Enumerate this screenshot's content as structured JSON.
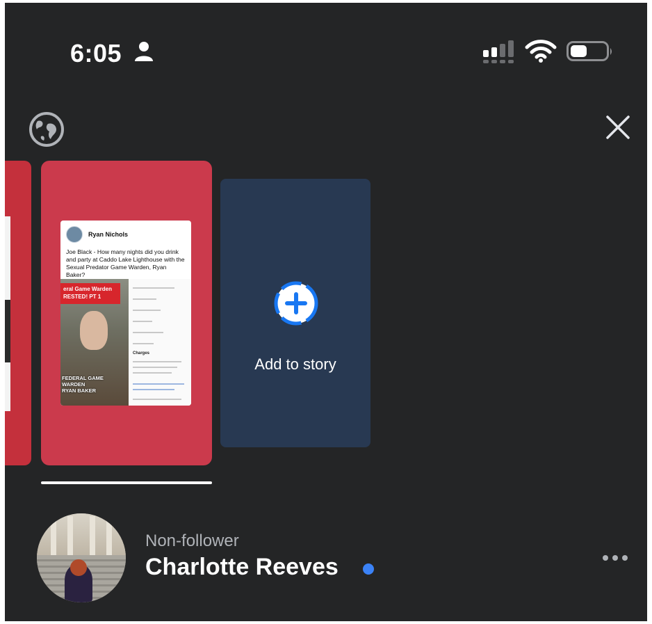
{
  "status_bar": {
    "time": "6:05",
    "person_icon": "person-icon",
    "signal_icon": "cellular-signal-icon",
    "wifi_icon": "wifi-icon",
    "battery_icon": "battery-icon",
    "battery_level": 0.45
  },
  "header": {
    "globe_icon": "globe-icon",
    "close_icon": "close-icon"
  },
  "story": {
    "post": {
      "author": "Ryan Nichols",
      "text": "Joe Black - How many nights did you drink and party at Caddo Lake Lighthouse with the Sexual Predator Game Warden, Ryan Baker?",
      "banner": "eral Game Warden\nRESTED! PT 1",
      "caption": "FEDERAL GAME WARDEN\nRYAN BAKER",
      "doc_heading": "Charges"
    }
  },
  "add_story": {
    "label": "Add to story",
    "icon": "add-circle-icon"
  },
  "viewer": {
    "status": "Non-follower",
    "name": "Charlotte Reeves",
    "online_color": "#3b82f6",
    "more_icon": "more-horizontal-icon"
  },
  "colors": {
    "background": "#242526",
    "story_card": "#cb3a4c",
    "add_card": "#283952",
    "accent": "#3b82f6"
  }
}
